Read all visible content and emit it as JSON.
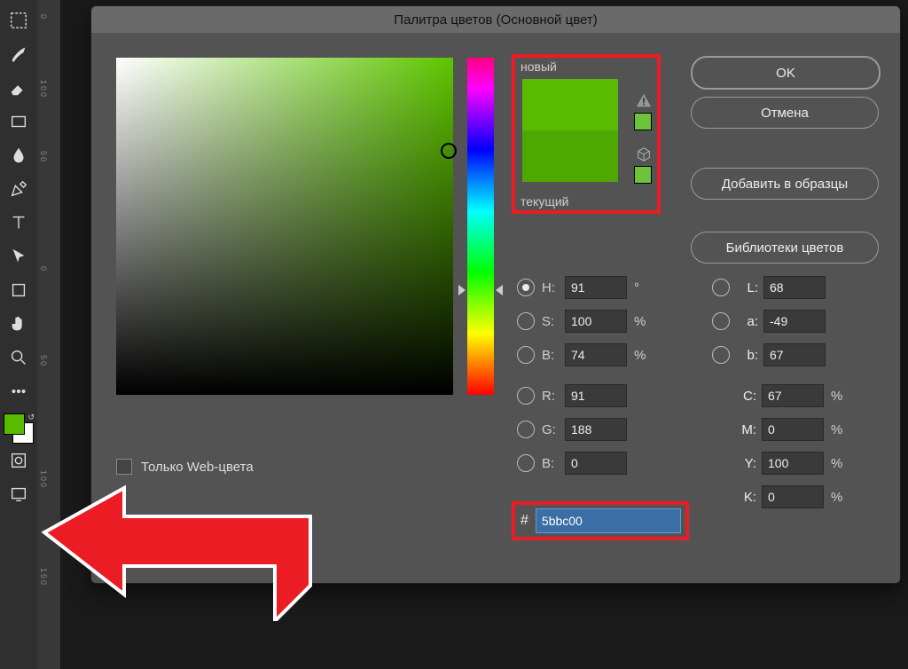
{
  "dialog": {
    "title": "Палитра цветов (Основной цвет)",
    "new_label": "новый",
    "current_label": "текущий",
    "buttons": {
      "ok": "OK",
      "cancel": "Отмена",
      "add_swatch": "Добавить в образцы",
      "libraries": "Библиотеки цветов"
    },
    "web_only": "Только Web-цвета",
    "hsb": {
      "h_label": "H:",
      "h": "91",
      "h_unit": "°",
      "s_label": "S:",
      "s": "100",
      "s_unit": "%",
      "b_label": "B:",
      "b": "74",
      "b_unit": "%"
    },
    "rgb": {
      "r_label": "R:",
      "r": "91",
      "g_label": "G:",
      "g": "188",
      "b_label": "B:",
      "b": "0"
    },
    "lab": {
      "l_label": "L:",
      "l": "68",
      "a_label": "a:",
      "a": "-49",
      "b_label": "b:",
      "b": "67"
    },
    "cmyk": {
      "c_label": "C:",
      "c": "67",
      "unit": "%",
      "m_label": "M:",
      "m": "0",
      "y_label": "Y:",
      "y": "100",
      "k_label": "K:",
      "k": "0"
    },
    "hex_label": "#",
    "hex": "5bbc00"
  },
  "ruler": {
    "m1": "0",
    "m2": "100",
    "m3": "50",
    "m4": "0",
    "m5": "50",
    "m6": "100",
    "m7": "150"
  },
  "colors": {
    "new": "#59bb00",
    "current": "#4fa800",
    "foreground": "#59bb00",
    "background": "#ffffff"
  }
}
